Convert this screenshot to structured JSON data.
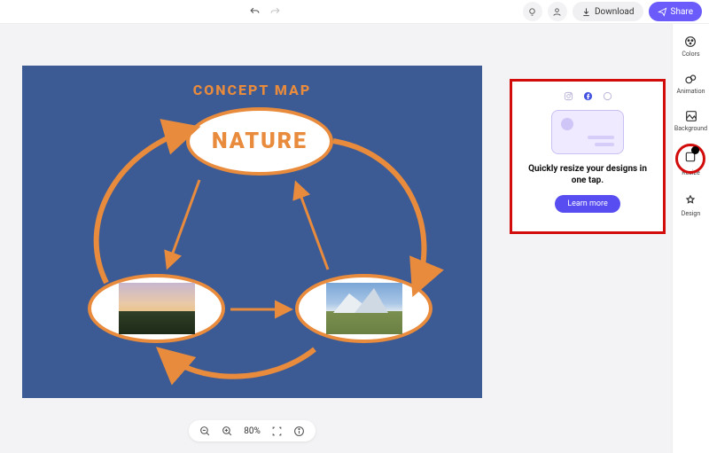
{
  "topbar": {
    "download_label": "Download",
    "share_label": "Share"
  },
  "sidebar": {
    "items": [
      {
        "label": "Colors"
      },
      {
        "label": "Animation"
      },
      {
        "label": "Background"
      },
      {
        "label": "Resize"
      },
      {
        "label": "Design"
      }
    ]
  },
  "canvas": {
    "title": "CONCEPT MAP",
    "main_node": "NATURE"
  },
  "popover": {
    "text": "Quickly resize your designs in one tap.",
    "cta": "Learn more"
  },
  "bottombar": {
    "zoom": "80%"
  }
}
